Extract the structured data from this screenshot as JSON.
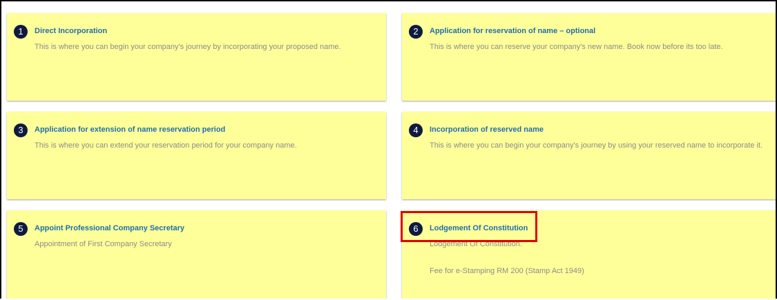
{
  "cards": [
    {
      "number": "1",
      "title": "Direct Incorporation",
      "description": "This is where you can begin your company's journey by incorporating your proposed name."
    },
    {
      "number": "2",
      "title": "Application for reservation of name – optional",
      "description": "This is where you can reserve your company's new name. Book now before its too late."
    },
    {
      "number": "3",
      "title": "Application for extension of name reservation period",
      "description": "This is where you can extend your reservation period for your company name."
    },
    {
      "number": "4",
      "title": "Incorporation of reserved name",
      "description": "This is where you can begin your company's journey by using your reserved name to incorporate it."
    },
    {
      "number": "5",
      "title": "Appoint Professional Company Secretary",
      "description": "Appointment of First Company Secretary"
    },
    {
      "number": "6",
      "title": "Lodgement Of Constitution",
      "description": "Lodgement Of Constitution.",
      "fee_note": "Fee for e-Stamping RM 200 (Stamp Act 1949)"
    }
  ],
  "colors": {
    "card_background": "#ffff9a",
    "title_text": "#1e6faa",
    "badge": "#0e1a3f",
    "highlight_border": "#e00000"
  }
}
